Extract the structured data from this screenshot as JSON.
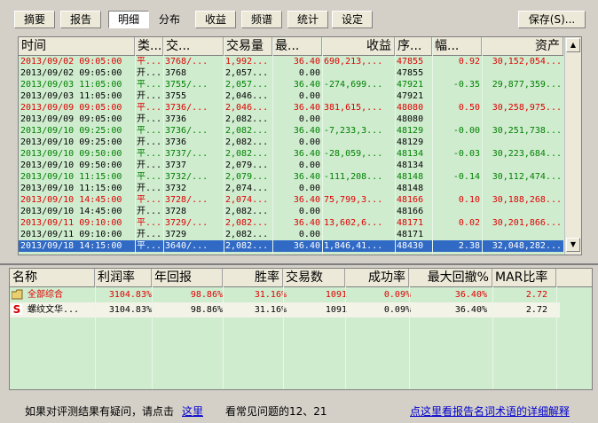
{
  "toolbar": {
    "tabs": [
      "摘要",
      "报告",
      "明细",
      "分布",
      "收益",
      "频谱",
      "统计",
      "设定"
    ],
    "active": "明细",
    "save_label": "保存(S)..."
  },
  "trades": {
    "columns": [
      "时间",
      "类...",
      "交...",
      "交易量",
      "最...",
      "收益",
      "序...",
      "幅...",
      "资产"
    ],
    "rows": [
      {
        "time": "2013/09/02 09:05:00",
        "type": "平...",
        "trade": "3768/...",
        "vol": "1,992...",
        "max": "36.40",
        "profit": "690,213,...",
        "seq": "47855",
        "amp": "0.92",
        "assets": "30,152,054...",
        "color": "red",
        "sel": false
      },
      {
        "time": "2013/09/02 09:05:00",
        "type": "开...",
        "trade": "3768",
        "vol": "2,057...",
        "max": "0.00",
        "profit": "",
        "seq": "47855",
        "amp": "",
        "assets": "",
        "color": "black",
        "sel": false
      },
      {
        "time": "2013/09/03 11:05:00",
        "type": "平...",
        "trade": "3755/...",
        "vol": "2,057...",
        "max": "36.40",
        "profit": "-274,699...",
        "seq": "47921",
        "amp": "-0.35",
        "assets": "29,877,359...",
        "color": "green",
        "sel": false
      },
      {
        "time": "2013/09/03 11:05:00",
        "type": "开...",
        "trade": "3755",
        "vol": "2,046...",
        "max": "0.00",
        "profit": "",
        "seq": "47921",
        "amp": "",
        "assets": "",
        "color": "black",
        "sel": false
      },
      {
        "time": "2013/09/09 09:05:00",
        "type": "平...",
        "trade": "3736/...",
        "vol": "2,046...",
        "max": "36.40",
        "profit": "381,615,...",
        "seq": "48080",
        "amp": "0.50",
        "assets": "30,258,975...",
        "color": "red",
        "sel": false
      },
      {
        "time": "2013/09/09 09:05:00",
        "type": "开...",
        "trade": "3736",
        "vol": "2,082...",
        "max": "0.00",
        "profit": "",
        "seq": "48080",
        "amp": "",
        "assets": "",
        "color": "black",
        "sel": false
      },
      {
        "time": "2013/09/10 09:25:00",
        "type": "平...",
        "trade": "3736/...",
        "vol": "2,082...",
        "max": "36.40",
        "profit": "-7,233,3...",
        "seq": "48129",
        "amp": "-0.00",
        "assets": "30,251,738...",
        "color": "green",
        "sel": false
      },
      {
        "time": "2013/09/10 09:25:00",
        "type": "开...",
        "trade": "3736",
        "vol": "2,082...",
        "max": "0.00",
        "profit": "",
        "seq": "48129",
        "amp": "",
        "assets": "",
        "color": "black",
        "sel": false
      },
      {
        "time": "2013/09/10 09:50:00",
        "type": "平...",
        "trade": "3737/...",
        "vol": "2,082...",
        "max": "36.40",
        "profit": "-28,059,...",
        "seq": "48134",
        "amp": "-0.03",
        "assets": "30,223,684...",
        "color": "green",
        "sel": false
      },
      {
        "time": "2013/09/10 09:50:00",
        "type": "开...",
        "trade": "3737",
        "vol": "2,079...",
        "max": "0.00",
        "profit": "",
        "seq": "48134",
        "amp": "",
        "assets": "",
        "color": "black",
        "sel": false
      },
      {
        "time": "2013/09/10 11:15:00",
        "type": "平...",
        "trade": "3732/...",
        "vol": "2,079...",
        "max": "36.40",
        "profit": "-111,208...",
        "seq": "48148",
        "amp": "-0.14",
        "assets": "30,112,474...",
        "color": "green",
        "sel": false
      },
      {
        "time": "2013/09/10 11:15:00",
        "type": "开...",
        "trade": "3732",
        "vol": "2,074...",
        "max": "0.00",
        "profit": "",
        "seq": "48148",
        "amp": "",
        "assets": "",
        "color": "black",
        "sel": false
      },
      {
        "time": "2013/09/10 14:45:00",
        "type": "平...",
        "trade": "3728/...",
        "vol": "2,074...",
        "max": "36.40",
        "profit": "75,799,3...",
        "seq": "48166",
        "amp": "0.10",
        "assets": "30,188,268...",
        "color": "red",
        "sel": false
      },
      {
        "time": "2013/09/10 14:45:00",
        "type": "开...",
        "trade": "3728",
        "vol": "2,082...",
        "max": "0.00",
        "profit": "",
        "seq": "48166",
        "amp": "",
        "assets": "",
        "color": "black",
        "sel": false
      },
      {
        "time": "2013/09/11 09:10:00",
        "type": "平...",
        "trade": "3729/...",
        "vol": "2,082...",
        "max": "36.40",
        "profit": "13,602,6...",
        "seq": "48171",
        "amp": "0.02",
        "assets": "30,201,866...",
        "color": "red",
        "sel": false
      },
      {
        "time": "2013/09/11 09:10:00",
        "type": "开...",
        "trade": "3729",
        "vol": "2,082...",
        "max": "0.00",
        "profit": "",
        "seq": "48171",
        "amp": "",
        "assets": "",
        "color": "black",
        "sel": false
      },
      {
        "time": "2013/09/18 14:15:00",
        "type": "平...",
        "trade": "3640/...",
        "vol": "2,082...",
        "max": "36.40",
        "profit": "1,846,41...",
        "seq": "48430",
        "amp": "2.38",
        "assets": "32,048,282...",
        "color": "red",
        "sel": true
      }
    ]
  },
  "summary": {
    "columns": [
      "名称",
      "利润率",
      "年回报",
      "胜率",
      "交易数",
      "成功率",
      "最大回撤%",
      "MAR比率"
    ],
    "rows": [
      {
        "name": "全部综合",
        "profit_rate": "3104.83%",
        "annual": "98.86%",
        "win": "31.16%",
        "trades": "1091",
        "success": "0.09%",
        "drawdown": "36.40%",
        "mar": "2.72",
        "color": "red",
        "icon": "folder-icon"
      },
      {
        "name": "螺纹文华...",
        "profit_rate": "3104.83%",
        "annual": "98.86%",
        "win": "31.16%",
        "trades": "1091",
        "success": "0.09%",
        "drawdown": "36.40%",
        "mar": "2.72",
        "color": "black",
        "icon": "strategy-s-icon"
      }
    ]
  },
  "footer": {
    "prefix": "如果对评测结果有疑问，请点击",
    "link1": "这里",
    "middle": "看常见问题的12、21",
    "link2": "点这里看报告名词术语的详细解释"
  },
  "colors": {
    "red": "#e00000",
    "green": "#008000",
    "black": "#000000",
    "selection": "#316ac5",
    "grid_bg": "#cfeccf"
  }
}
